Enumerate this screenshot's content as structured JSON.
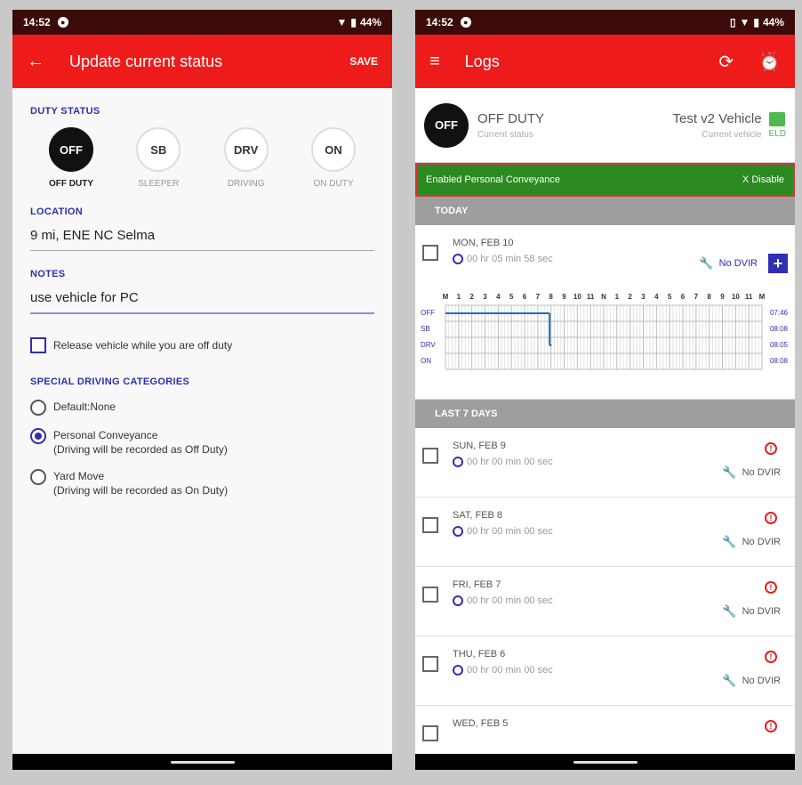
{
  "left": {
    "status_bar": {
      "time": "14:52",
      "battery": "44%"
    },
    "app_bar": {
      "back_icon": "arrow-left-icon",
      "title": "Update current status",
      "save_label": "SAVE"
    },
    "duty_status": {
      "label": "DUTY STATUS",
      "options": [
        {
          "code": "OFF",
          "label": "OFF DUTY",
          "selected": true
        },
        {
          "code": "SB",
          "label": "SLEEPER",
          "selected": false
        },
        {
          "code": "DRV",
          "label": "DRIVING",
          "selected": false
        },
        {
          "code": "ON",
          "label": "ON DUTY",
          "selected": false
        }
      ]
    },
    "location": {
      "label": "LOCATION",
      "value": "9 mi, ENE NC Selma"
    },
    "notes": {
      "label": "NOTES",
      "value": "use vehicle for PC"
    },
    "release_vehicle": {
      "label": "Release vehicle while you are off duty",
      "checked": false
    },
    "special_driving": {
      "label": "SPECIAL DRIVING CATEGORIES",
      "options": [
        {
          "line1": "Default:None",
          "line2": "",
          "checked": false
        },
        {
          "line1": "Personal Conveyance",
          "line2": "(Driving will be recorded as Off Duty)",
          "checked": true
        },
        {
          "line1": "Yard Move",
          "line2": "(Driving will be recorded as On Duty)",
          "checked": false
        }
      ]
    }
  },
  "right": {
    "status_bar": {
      "time": "14:52",
      "battery": "44%"
    },
    "app_bar": {
      "menu_icon": "hamburger-menu-icon",
      "title": "Logs",
      "sync_icon": "sync-icon",
      "alarm_icon": "alarm-clock-icon"
    },
    "current": {
      "code": "OFF",
      "status": "OFF DUTY",
      "status_sub": "Current status",
      "vehicle": "Test v2 Vehicle",
      "vehicle_sub": "Current vehicle",
      "eld_label": "ELD",
      "eld_color": "#4fb84f"
    },
    "banner": {
      "text": "Enabled Personal Conveyance",
      "action": "X Disable",
      "color": "#2d8a22"
    },
    "today_header": "TODAY",
    "today": {
      "date": "MON, FEB 10",
      "duration": "00 hr 05 min 58 sec",
      "dvir": "No DVIR",
      "hours": [
        "M",
        "1",
        "2",
        "3",
        "4",
        "5",
        "6",
        "7",
        "8",
        "9",
        "10",
        "11",
        "N",
        "1",
        "2",
        "3",
        "4",
        "5",
        "6",
        "7",
        "8",
        "9",
        "10",
        "11",
        "M"
      ],
      "rows": [
        "OFF",
        "SB",
        "DRV",
        "ON"
      ],
      "totals": [
        "07:46",
        "08:08",
        "08:05",
        "08:08"
      ],
      "segments": [
        {
          "row": 0,
          "start": 0,
          "end": 7.9
        },
        {
          "row": 2,
          "start": 7.9,
          "end": 8.05
        }
      ]
    },
    "last7_header": "LAST 7 DAYS",
    "days": [
      {
        "date": "SUN, FEB 9",
        "duration": "00 hr 00 min 00 sec",
        "dvir": "No DVIR"
      },
      {
        "date": "SAT, FEB 8",
        "duration": "00 hr 00 min 00 sec",
        "dvir": "No DVIR"
      },
      {
        "date": "FRI, FEB 7",
        "duration": "00 hr 00 min 00 sec",
        "dvir": "No DVIR"
      },
      {
        "date": "THU, FEB 6",
        "duration": "00 hr 00 min 00 sec",
        "dvir": "No DVIR"
      },
      {
        "date": "WED, FEB 5",
        "duration": "",
        "dvir": ""
      }
    ],
    "accent_color": "#ee1b1b",
    "link_color": "#2f2fb0"
  }
}
